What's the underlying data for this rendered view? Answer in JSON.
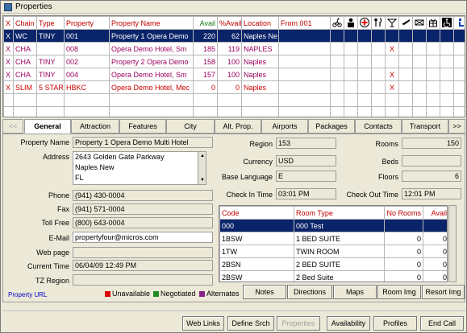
{
  "window": {
    "title": "Properties"
  },
  "grid": {
    "columns": [
      "X",
      "Chain",
      "Type",
      "Property",
      "Property Name",
      "Avail",
      "%Avail",
      "Location",
      "From 001"
    ],
    "header_icons": [
      "cyclist-icon",
      "person-icon",
      "medical-cross-icon",
      "dining-icon",
      "cocktail-icon",
      "airplane-icon",
      "ticket-icon",
      "gift-icon",
      "accessibility-icon",
      "concierge-icon"
    ],
    "rows": [
      {
        "x": "X",
        "chain": "WC",
        "type": "TINY",
        "property": "001",
        "name": "Property 1 Opera Demo",
        "avail": "220",
        "pct": "62",
        "location": "Naples Ne",
        "from": "",
        "mark": "",
        "selected": true
      },
      {
        "x": "X",
        "chain": "CHA",
        "type": "",
        "property": "008",
        "name": "Opera Demo Hotel, Sm",
        "avail": "185",
        "pct": "119",
        "location": "NAPLES",
        "from": "",
        "mark": "X"
      },
      {
        "x": "X",
        "chain": "CHA",
        "type": "TINY",
        "property": "002",
        "name": "Property 2 Opera Demo",
        "avail": "158",
        "pct": "100",
        "location": "Naples",
        "from": "",
        "mark": ""
      },
      {
        "x": "X",
        "chain": "CHA",
        "type": "TINY",
        "property": "004",
        "name": "Opera Demo Hotel, Sm",
        "avail": "157",
        "pct": "100",
        "location": "Naples",
        "from": "",
        "mark": "X"
      },
      {
        "x": "X",
        "chain": "SLIM",
        "type": "5 STAR",
        "property": "HBKC",
        "name": "Opera Demo Hotel, Mec",
        "avail": "0",
        "pct": "0",
        "location": "Naples",
        "from": "",
        "mark": "X",
        "red": true
      }
    ]
  },
  "tabs": {
    "prev": "<<",
    "items": [
      "General",
      "Attraction",
      "Features",
      "City",
      "Alt. Prop.",
      "Airports",
      "Packages",
      "Contacts",
      "Transport"
    ],
    "next": ">>",
    "active": "General"
  },
  "general": {
    "property_name_label": "Property Name",
    "property_name": "Property 1 Opera Demo Multi Hotel",
    "address_label": "Address",
    "address_lines": [
      "2643 Golden Gate Parkway",
      "Naples New",
      "FL"
    ],
    "phone_label": "Phone",
    "phone": "(941) 430-0004",
    "fax_label": "Fax",
    "fax": "(941) 571-0004",
    "tollfree_label": "Toll Free",
    "tollfree": "(800) 643-0004",
    "email_label": "E-Mail",
    "email": "propertyfour@micros.com",
    "webpage_label": "Web page",
    "webpage": "",
    "current_time_label": "Current Time",
    "current_time": "06/04/09 12:49 PM",
    "tz_label": "TZ Region",
    "tz": "",
    "region_label": "Region",
    "region": "153",
    "currency_label": "Currency",
    "currency": "USD",
    "base_language_label": "Base Language",
    "base_language": "E",
    "checkin_label": "Check In Time",
    "checkin": "03:01 PM",
    "rooms_label": "Rooms",
    "rooms": "150",
    "beds_label": "Beds",
    "beds": "",
    "floors_label": "Floors",
    "floors": "6",
    "checkout_label": "Check Out Time",
    "checkout": "12:01 PM",
    "property_url": "Property URL"
  },
  "room_table": {
    "columns": [
      "Code",
      "Room Type",
      "No Rooms",
      "Avail"
    ],
    "rows": [
      {
        "code": "000",
        "type": "000 Test",
        "no_rooms": "",
        "avail": "",
        "selected": true
      },
      {
        "code": "1BSW",
        "type": "1 BED SUITE",
        "no_rooms": "0",
        "avail": "0"
      },
      {
        "code": "1TW",
        "type": "TWIN ROOM",
        "no_rooms": "0",
        "avail": "0"
      },
      {
        "code": "2BSN",
        "type": "2 BED SUITE",
        "no_rooms": "0",
        "avail": "0"
      },
      {
        "code": "2BSW",
        "type": "2 Bed Suite",
        "no_rooms": "0",
        "avail": "0"
      }
    ]
  },
  "legend": [
    {
      "label": "Unavailable",
      "color": "#e00000"
    },
    {
      "label": "Negotiated",
      "color": "#1f8a1f"
    },
    {
      "label": "Alternates",
      "color": "#8a1f8a"
    }
  ],
  "panel_buttons": [
    "Notes",
    "Directions",
    "Maps",
    "Room Img",
    "Resort Img"
  ],
  "footer_buttons": [
    "Web Links",
    "Define Srch",
    "Properties",
    "Availability",
    "Profiles",
    "End Call"
  ]
}
